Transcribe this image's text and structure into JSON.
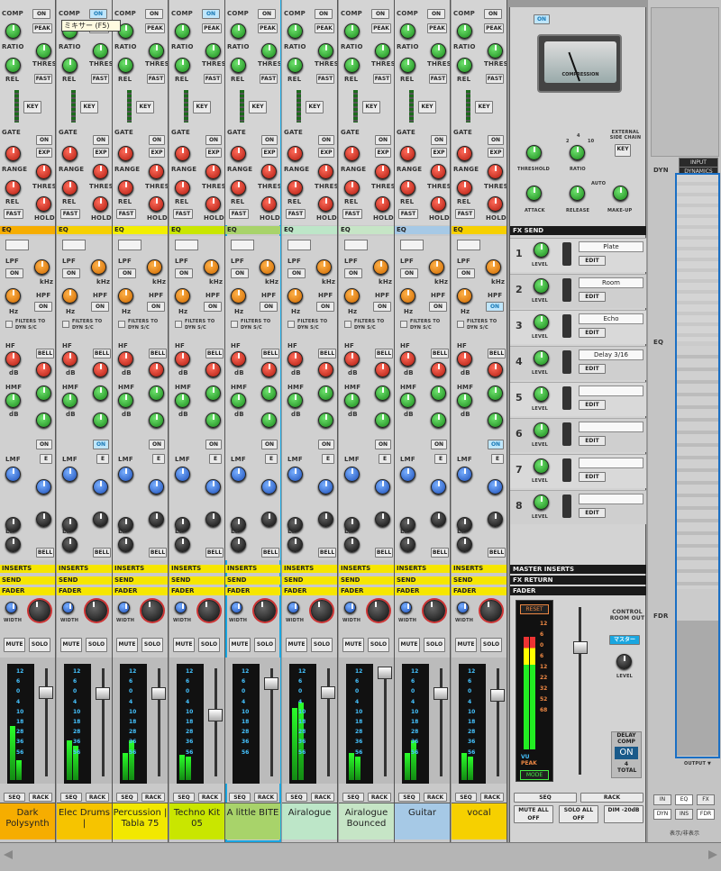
{
  "tooltip": "ミキサー (F5)",
  "labels": {
    "comp": "COMP",
    "ratio": "RATIO",
    "thres": "THRES",
    "rel": "REL",
    "peak": "PEAK",
    "fast": "FAST",
    "key": "KEY",
    "gate": "GATE",
    "exp": "EXP",
    "range": "RANGE",
    "hold": "HOLD",
    "on": "ON",
    "eq": "EQ",
    "lpf": "LPF",
    "hpf": "HPF",
    "khz": "kHz",
    "hz": "Hz",
    "filters": "FILTERS TO",
    "dyn_sc": "DYN S/C",
    "hf": "HF",
    "hmf": "HMF",
    "lmf": "LMF",
    "lf": "LF",
    "bell": "BELL",
    "db": "dB",
    "q": "Q",
    "e": "E",
    "inserts": "INSERTS",
    "send": "SEND",
    "fader": "FADER",
    "width": "WIDTH",
    "l": "L",
    "r": "R",
    "mute": "MUTE",
    "solo": "SOLO",
    "seq": "SEQ",
    "rack": "RACK"
  },
  "scale": [
    "12",
    "6",
    "0",
    "4",
    "10",
    "18",
    "28",
    "36",
    "56"
  ],
  "channels": [
    {
      "name": "Dark Polysynth",
      "color": "#f6ad00",
      "eq_color": "#f6ad00"
    },
    {
      "name": "Elec Drums |",
      "color": "#f6c400",
      "eq_color": "#f6d000"
    },
    {
      "name": "Percussion | Tabla 75",
      "color": "#f2e800",
      "eq_color": "#f2ee00"
    },
    {
      "name": "Techno Kit 05",
      "color": "#c9e600",
      "eq_color": "#c9e600"
    },
    {
      "name": "A little BITE",
      "color": "#a8d36a",
      "eq_color": "#a8d36a"
    },
    {
      "name": "Airalogue",
      "color": "#bde6c8",
      "eq_color": "#bde6c8"
    },
    {
      "name": "Airalogue Bounced",
      "color": "#c6e5c6",
      "eq_color": "#c6e5c6"
    },
    {
      "name": "Guitar",
      "color": "#a6c9e6",
      "eq_color": "#a6c9e6"
    },
    {
      "name": "vocal",
      "color": "#f6d000",
      "eq_color": "#f6d000"
    }
  ],
  "master": {
    "on": "ON",
    "meter_text": "COMPRESSION",
    "ext_sc": "EXTERNAL SIDE CHAIN",
    "key": "KEY",
    "threshold": "THRESHOLD",
    "ratio": "RATIO",
    "attack": "ATTACK",
    "release": "RELEASE",
    "auto": "AUTO",
    "makeup": "MAKE-UP",
    "ratio_marks": [
      "2",
      "4",
      "10"
    ],
    "fx_send": "FX SEND",
    "level": "LEVEL",
    "edit": "EDIT",
    "fx": [
      {
        "num": "1",
        "name": "Plate"
      },
      {
        "num": "2",
        "name": "Room"
      },
      {
        "num": "3",
        "name": "Echo"
      },
      {
        "num": "4",
        "name": "Delay 3/16"
      },
      {
        "num": "5",
        "name": ""
      },
      {
        "num": "6",
        "name": ""
      },
      {
        "num": "7",
        "name": ""
      },
      {
        "num": "8",
        "name": ""
      }
    ],
    "master_inserts": "MASTER INSERTS",
    "fx_return": "FX RETURN",
    "fader": "FADER",
    "reset": "RESET",
    "mode": "MODE",
    "vu": "VU",
    "peak": "PEAK",
    "ctrl_room": "CONTROL ROOM OUT",
    "master_btn": "マスター",
    "level2": "LEVEL",
    "delay_comp": "DELAY COMP",
    "dc_on": "ON",
    "total": "4 TOTAL",
    "seq": "SEQ",
    "rack": "RACK",
    "mute_all": "MUTE ALL OFF",
    "solo_all": "SOLO ALL OFF",
    "dim": "DIM -20dB",
    "scale": [
      "12",
      "6",
      "0",
      "6",
      "12",
      "22",
      "32",
      "52",
      "68"
    ]
  },
  "nav": {
    "input": "INPUT",
    "dyn": "DYN",
    "dynamics": "DYNAMICS",
    "eq": "EQ",
    "fdr": "FDR",
    "inserts": "INSERTS",
    "send": "SEND",
    "fader": "FADER",
    "output": "OUTPUT ▼",
    "btns": [
      "IN",
      "EQ",
      "FX",
      "DYN",
      "INS",
      "FDR"
    ],
    "show_hide": "表示/非表示"
  }
}
